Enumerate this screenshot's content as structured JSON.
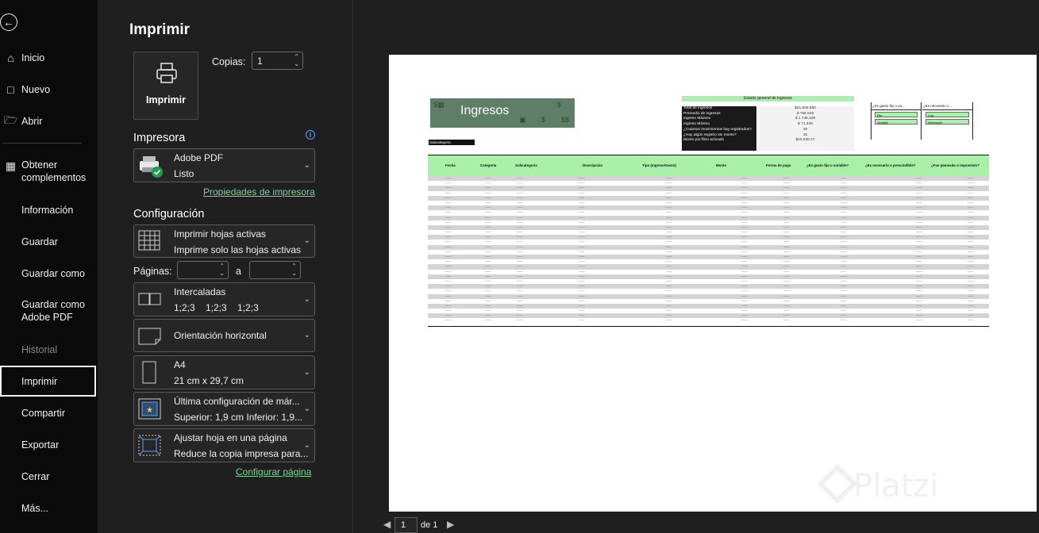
{
  "nav": {
    "items": [
      {
        "label": "Inicio",
        "icon": "home-icon"
      },
      {
        "label": "Nuevo",
        "icon": "new-document-icon"
      },
      {
        "label": "Abrir",
        "icon": "folder-open-icon"
      },
      {
        "label": "Obtener complementos",
        "icon": "grid-icon"
      },
      {
        "label": "Información"
      },
      {
        "label": "Guardar"
      },
      {
        "label": "Guardar como"
      },
      {
        "label": "Guardar como Adobe PDF"
      },
      {
        "label": "Historial"
      },
      {
        "label": "Imprimir"
      },
      {
        "label": "Compartir"
      },
      {
        "label": "Exportar"
      },
      {
        "label": "Cerrar"
      },
      {
        "label": "Más..."
      }
    ],
    "active": "Imprimir"
  },
  "panel": {
    "title": "Imprimir",
    "print_button": "Imprimir",
    "copies_label": "Copias:",
    "copies_value": "1",
    "printer_section": "Impresora",
    "printer_name": "Adobe PDF",
    "printer_status": "Listo",
    "printer_props_link": "Propiedades de impresora",
    "config_section": "Configuración",
    "settings": [
      {
        "line1": "Imprimir hojas activas",
        "line2": "Imprime solo las hojas activas"
      },
      {
        "line1": "Intercaladas",
        "line2": "1;2;3    1;2;3    1;2;3"
      },
      {
        "line1": "Orientación horizontal",
        "line2": ""
      },
      {
        "line1": "A4",
        "line2": "21 cm x 29,7 cm"
      },
      {
        "line1": "Última configuración de már...",
        "line2": "Superior: 1,9 cm Inferior: 1,9..."
      },
      {
        "line1": "Ajustar hoja en una página",
        "line2": "Reduce la copia impresa para..."
      }
    ],
    "pages_label": "Páginas:",
    "pages_to": "a",
    "page_setup_link": "Configurar página"
  },
  "preview": {
    "banner_title": "Ingresos",
    "subcategory_label": "Subcategoría",
    "summary_title": "Estado general de ingresos",
    "summary_labels": [
      "Total de ingresos",
      "Promedio de ingresos",
      "Ingreso Máximo",
      "Ingreso Mínimo",
      "¿Cuántos movimientos hay registrados?",
      "¿Hay algún registro sin monto?",
      "Monto por filtro activado"
    ],
    "summary_values": [
      "$21.503.550",
      "$ 766.626",
      "$ 1.736.498",
      "$ 71.449",
      "29",
      "30",
      "$20.536.47"
    ],
    "mini1": {
      "header": "¿Es gasto fijo o va...",
      "cells": [
        "Fijo",
        "Variable"
      ]
    },
    "mini2": {
      "header": "¿Es necesario o ...",
      "cells": [
        "Lujo",
        "Necesario"
      ]
    },
    "table_headers": [
      "Fecha",
      "Categoría",
      "Subcategoría",
      "Descripción",
      "Tipo (Ingreso/Gasto)",
      "Monto",
      "Forma de pago",
      "¿Es gasto fijo o variable?",
      "¿Es necesario o prescindible?",
      "¿Fue planeado o imprevisto?"
    ],
    "row_count": 30,
    "page_current": "1",
    "page_of": "de 1",
    "watermark": "Platzi"
  },
  "colors": {
    "accent_green": "#7fd49a",
    "table_header": "#a9f0a9",
    "banner": "#5e7e67"
  }
}
